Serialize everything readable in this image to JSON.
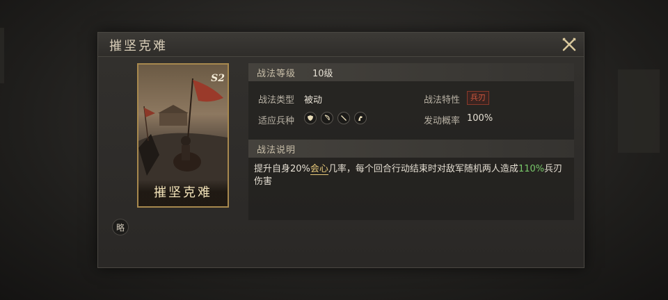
{
  "modal": {
    "title": "摧坚克难"
  },
  "card": {
    "name": "摧坚克难",
    "grade": "S2"
  },
  "brief_button": "略",
  "level_section": {
    "label": "战法等级",
    "value": "10级"
  },
  "attributes": {
    "type_label": "战法类型",
    "type_value": "被动",
    "trait_label": "战法特性",
    "trait_value": "兵刃",
    "units_label": "适应兵种",
    "units": [
      "shield-icon",
      "bow-icon",
      "spear-icon",
      "horse-icon"
    ],
    "chance_label": "发动概率",
    "chance_value": "100%"
  },
  "description_section": {
    "label": "战法说明",
    "text_part1": "提升自身20%",
    "text_highlight1": "会心",
    "text_part2": "几率，每个回合行动结束时对敌军随机两人造成",
    "text_highlight2": "110%",
    "text_part3": "兵刃伤害"
  },
  "colors": {
    "accent_gold": "#e8c97a",
    "accent_green": "#79c86a",
    "trait_red": "#d2583f",
    "card_border": "#a8894e"
  }
}
